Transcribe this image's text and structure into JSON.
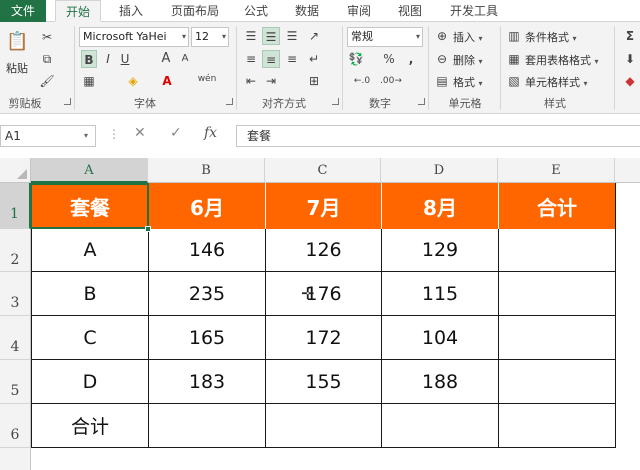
{
  "tabs": [
    "文件",
    "开始",
    "插入",
    "页面布局",
    "公式",
    "数据",
    "审阅",
    "视图",
    "开发工具"
  ],
  "ribbon": {
    "clipboard": {
      "paste": "粘贴",
      "label": "剪贴板"
    },
    "font": {
      "name": "Microsoft YaHei",
      "size": "12",
      "bold": "B",
      "italic": "I",
      "underline": "U",
      "grow": "A",
      "shrink": "A",
      "phonetic": "wén",
      "label": "字体"
    },
    "alignment": {
      "label": "对齐方式"
    },
    "number": {
      "format": "常规",
      "percent": "%",
      "comma": ",",
      "label": "数字"
    },
    "cells": {
      "insert": "插入",
      "delete": "删除",
      "format": "格式",
      "label": "单元格"
    },
    "styles": {
      "conditional": "条件格式",
      "table": "套用表格格式",
      "cell": "单元格样式",
      "label": "样式"
    }
  },
  "formula_bar": {
    "name_box": "A1",
    "fx": "fx",
    "content": "套餐"
  },
  "columns": [
    "A",
    "B",
    "C",
    "D",
    "E"
  ],
  "rows": [
    "1",
    "2",
    "3",
    "4",
    "5",
    "6"
  ],
  "table": {
    "header": [
      "套餐",
      "6月",
      "7月",
      "8月",
      "合计"
    ],
    "body": [
      [
        "A",
        "146",
        "126",
        "129",
        ""
      ],
      [
        "B",
        "235",
        "176",
        "115",
        ""
      ],
      [
        "C",
        "165",
        "172",
        "104",
        ""
      ],
      [
        "D",
        "183",
        "155",
        "188",
        ""
      ],
      [
        "合计",
        "",
        "",
        "",
        ""
      ]
    ]
  },
  "colors": {
    "accent": "#217346",
    "header_fill": "#ff6600"
  }
}
